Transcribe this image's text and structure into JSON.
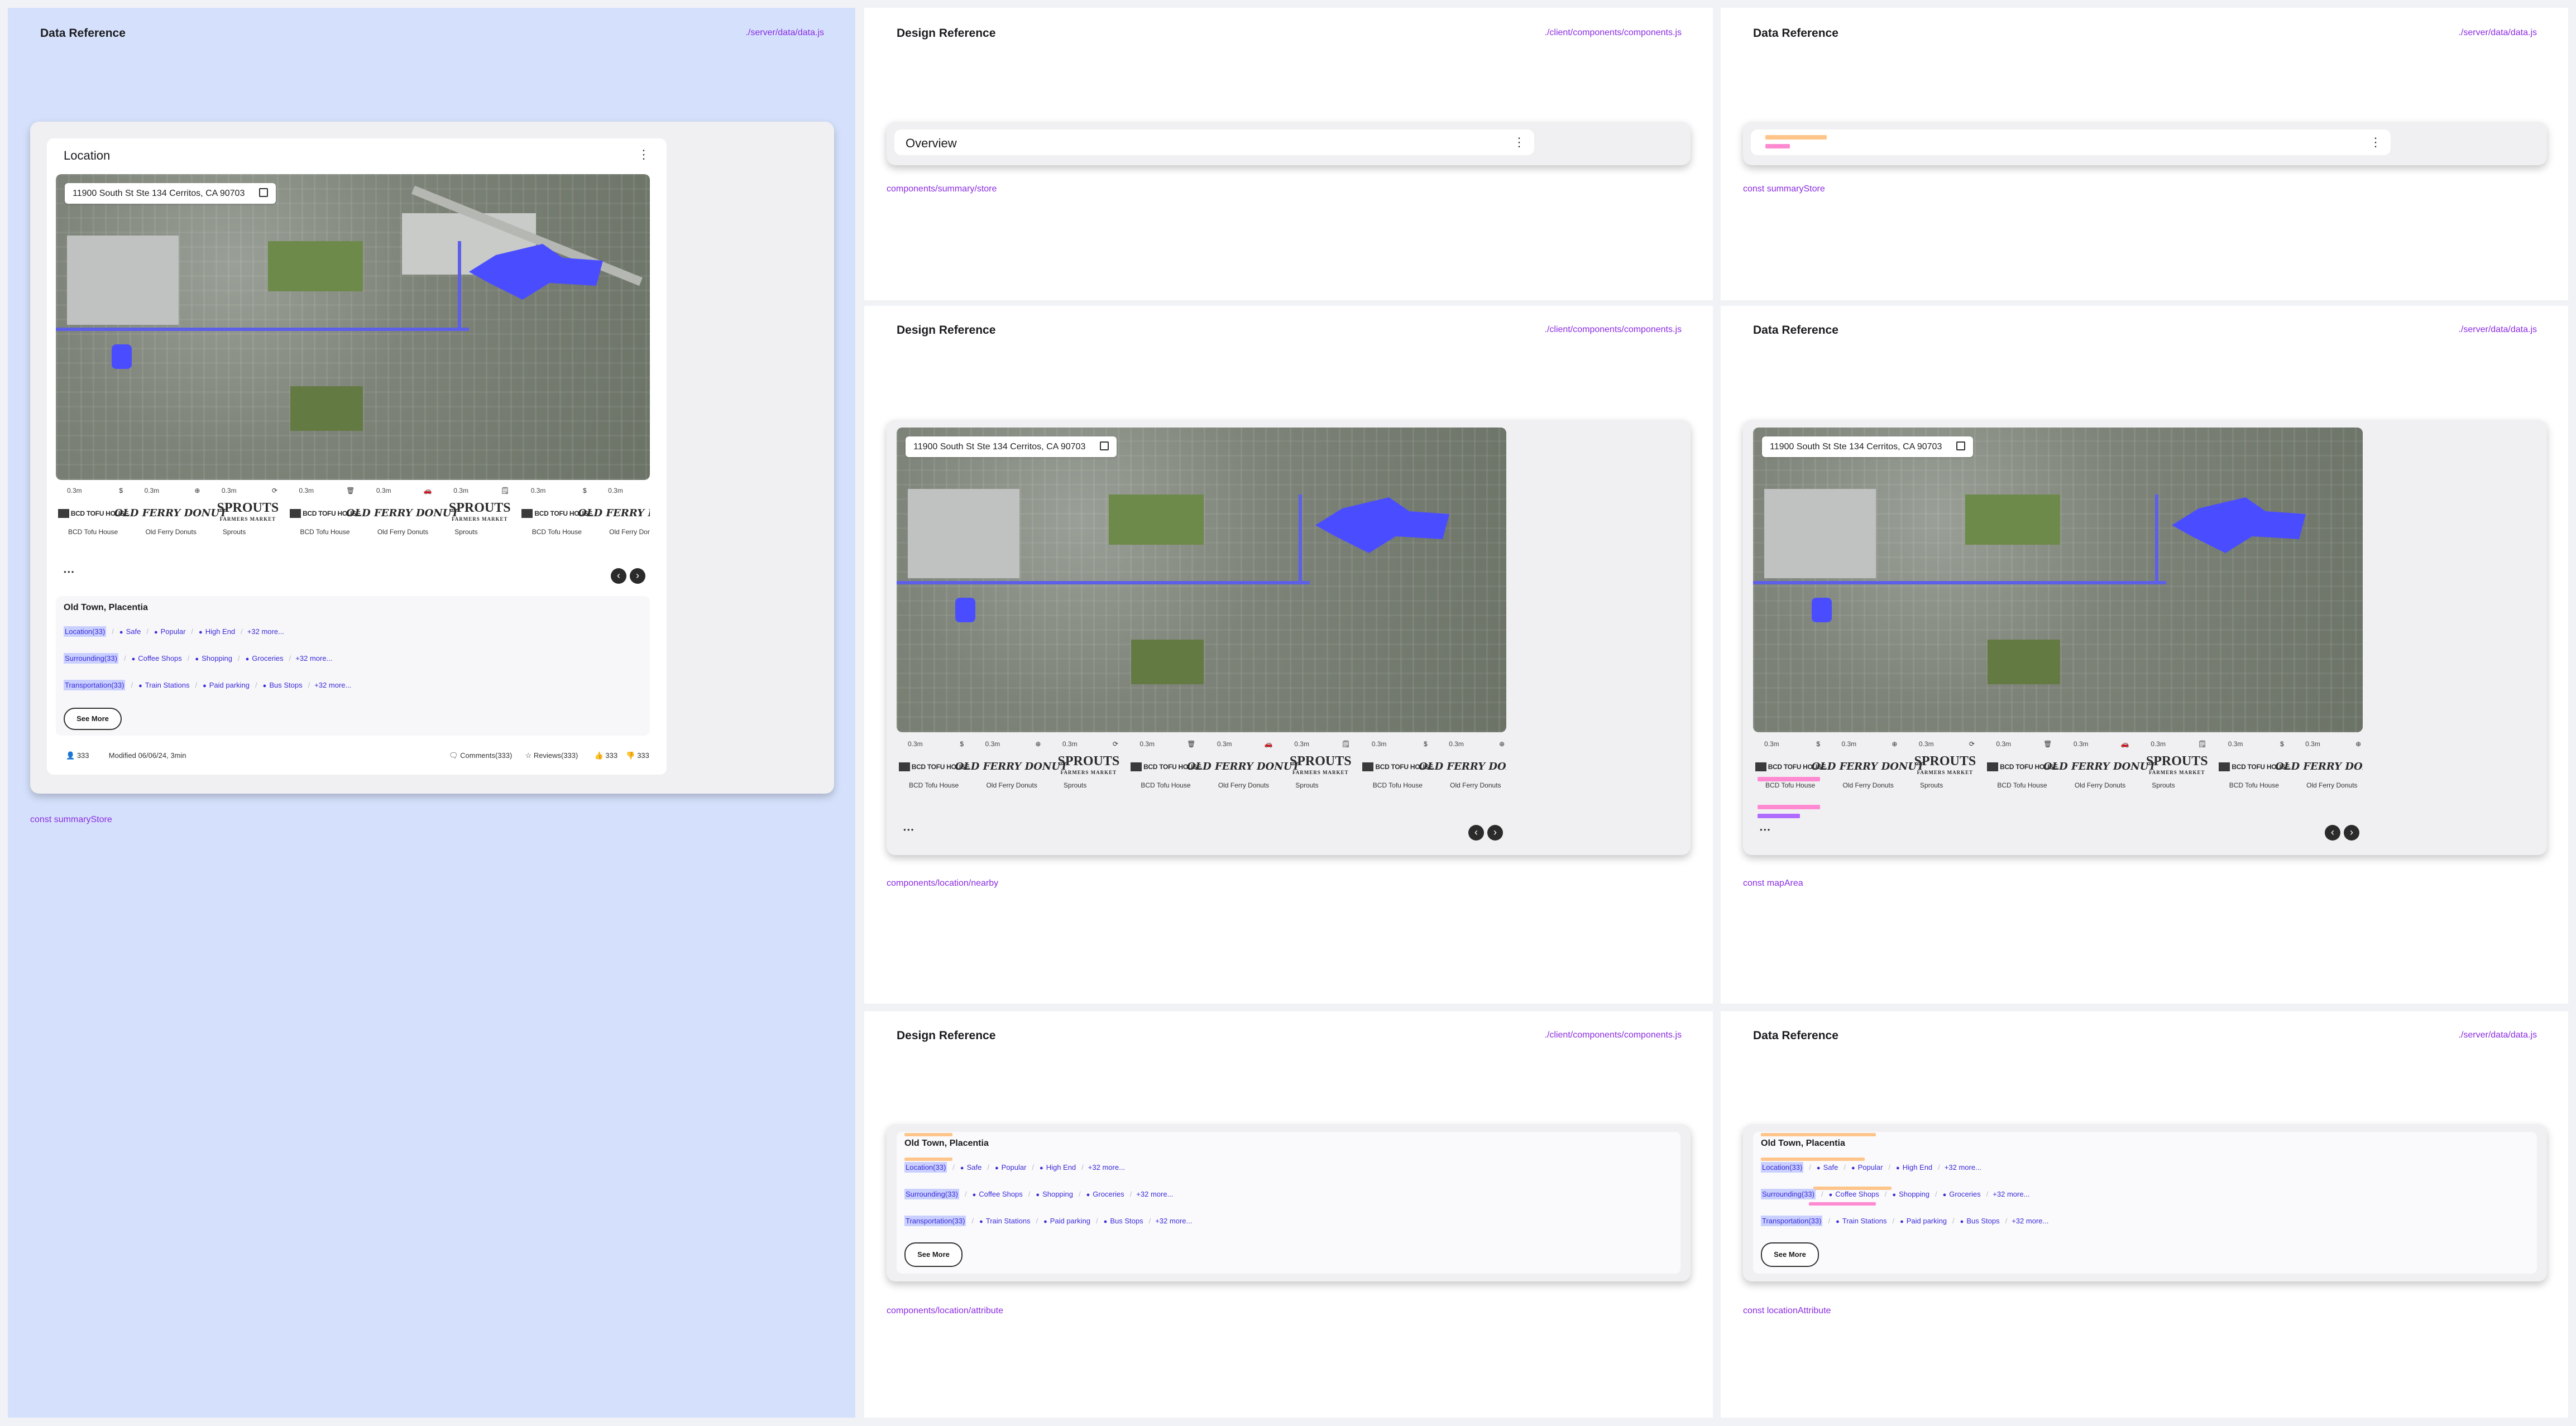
{
  "panels": {
    "data_reference": "Data Reference",
    "design_reference": "Design Reference",
    "server_path": "./server/data/data.js",
    "client_path": "./client/components/components.js"
  },
  "captions": {
    "summary_store_const": "const summaryStore",
    "summary_store_component": "components/summary/store",
    "nearby_component": "components/location/nearby",
    "map_area_const": "const mapArea",
    "attribute_component": "components/location/attribute",
    "attribute_const": "const locationAttribute"
  },
  "card": {
    "title": "Location",
    "overview_title": "Overview",
    "kebab": "⋮",
    "address": "11900 South St Ste 134 Cerritos, CA 90703"
  },
  "nearby": {
    "items": [
      {
        "dist": "0.3m",
        "cat": "$",
        "name": "BCD Tofu House",
        "logo": "bcd"
      },
      {
        "dist": "0.3m",
        "cat": "⊕",
        "name": "Old Ferry Donuts",
        "logo": "ferry"
      },
      {
        "dist": "0.3m",
        "cat": "⟳",
        "name": "Sprouts",
        "logo": "sprouts"
      },
      {
        "dist": "0.3m",
        "cat": "🗑",
        "name": "BCD Tofu House",
        "logo": "bcd"
      },
      {
        "dist": "0.3m",
        "cat": "🚗",
        "name": "Old Ferry Donuts",
        "logo": "ferry"
      },
      {
        "dist": "0.3m",
        "cat": "🗒",
        "name": "Sprouts",
        "logo": "sprouts"
      },
      {
        "dist": "0.3m",
        "cat": "$",
        "name": "BCD Tofu House",
        "logo": "bcd"
      },
      {
        "dist": "0.3m",
        "cat": "⊕",
        "name": "Old Ferry Donuts",
        "logo": "ferry"
      }
    ],
    "logo_text": {
      "bcd": "BCD TOFU HOUSE",
      "ferry": "OLD FERRY DONUT",
      "sprouts": "SPROUTS",
      "sprouts_sub": "FARMERS MARKET"
    },
    "dots": "●●●",
    "prev": "‹",
    "next": "›"
  },
  "attributes": {
    "title": "Old Town, Placentia",
    "rows": [
      {
        "chip": "Location(33)",
        "tags": [
          "Safe",
          "Popular",
          "High End"
        ],
        "more": "+32 more..."
      },
      {
        "chip": "Surrounding(33)",
        "tags": [
          "Coffee Shops",
          "Shopping",
          "Groceries"
        ],
        "more": "+32 more..."
      },
      {
        "chip": "Transportation(33)",
        "tags": [
          "Train Stations",
          "Paid parking",
          "Bus Stops"
        ],
        "more": "+32 more..."
      }
    ],
    "see_more": "See More"
  },
  "footer": {
    "views": "333",
    "modified": "Modified 06/06/24, 3min",
    "comments": "Comments(333)",
    "reviews": "Reviews(333)",
    "likes": "333",
    "dislikes": "333"
  },
  "colors": {
    "accent_purple": "#8a2be2",
    "chip_bg": "#c9d0ff",
    "tag_blue": "#3a2bd8",
    "map_highlight": "#4a4dff",
    "data_panel_bg": "#d5e1fc"
  }
}
